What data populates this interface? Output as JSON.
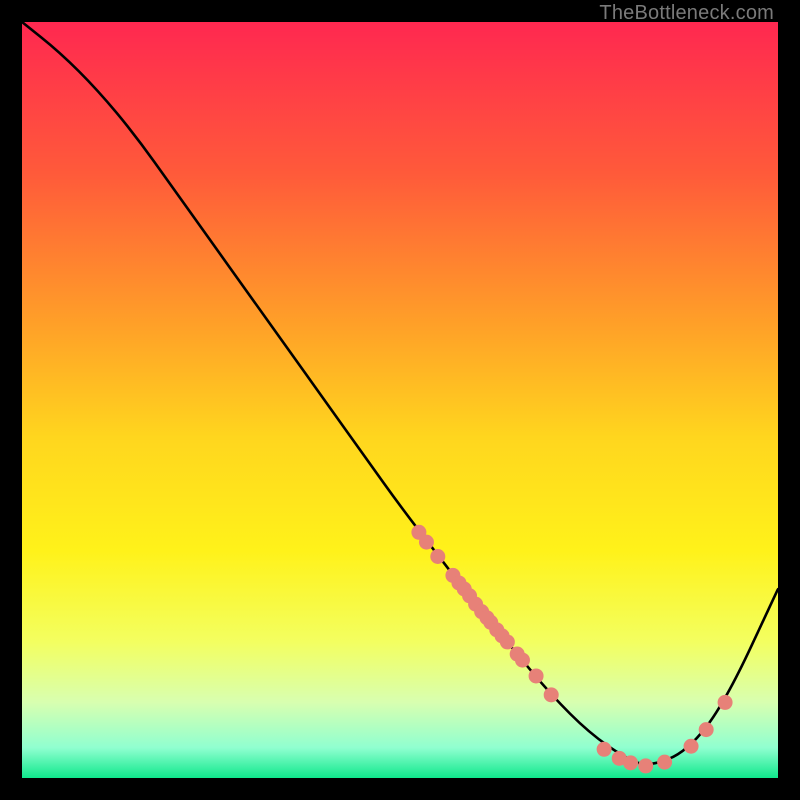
{
  "watermark": "TheBottleneck.com",
  "chart_data": {
    "type": "line",
    "title": "",
    "xlabel": "",
    "ylabel": "",
    "xlim": [
      0,
      100
    ],
    "ylim": [
      0,
      100
    ],
    "grid": false,
    "series": [
      {
        "name": "curve",
        "x": [
          0,
          5,
          10,
          15,
          20,
          25,
          30,
          35,
          40,
          45,
          50,
          55,
          60,
          65,
          70,
          75,
          80,
          83,
          88,
          93,
          100
        ],
        "y": [
          100,
          96,
          91,
          85,
          78,
          71,
          64,
          57,
          50,
          43,
          36,
          29.5,
          23,
          17,
          11,
          6,
          2.5,
          1.5,
          3.5,
          10,
          25
        ]
      }
    ],
    "markers": {
      "name": "dots",
      "color": "#e78178",
      "x": [
        52.5,
        53.5,
        55,
        57,
        57.8,
        58.5,
        59.2,
        60,
        60.8,
        61.5,
        62,
        62.8,
        63.5,
        64.2,
        65.5,
        66.2,
        68,
        70,
        77,
        79,
        80.5,
        82.5,
        85,
        88.5,
        90.5,
        93
      ],
      "y": [
        32.5,
        31.2,
        29.3,
        26.8,
        25.8,
        25,
        24.1,
        23,
        22,
        21.2,
        20.6,
        19.6,
        18.8,
        18,
        16.4,
        15.6,
        13.5,
        11,
        3.8,
        2.6,
        2.0,
        1.6,
        2.1,
        4.2,
        6.4,
        10
      ]
    },
    "gradient_stops": [
      {
        "offset": 0.0,
        "color": "#ff2850"
      },
      {
        "offset": 0.2,
        "color": "#ff5a3a"
      },
      {
        "offset": 0.4,
        "color": "#ffa028"
      },
      {
        "offset": 0.55,
        "color": "#ffd61e"
      },
      {
        "offset": 0.7,
        "color": "#fff21a"
      },
      {
        "offset": 0.82,
        "color": "#f3ff60"
      },
      {
        "offset": 0.9,
        "color": "#d8ffb0"
      },
      {
        "offset": 0.96,
        "color": "#90ffd0"
      },
      {
        "offset": 1.0,
        "color": "#10e88c"
      }
    ]
  }
}
